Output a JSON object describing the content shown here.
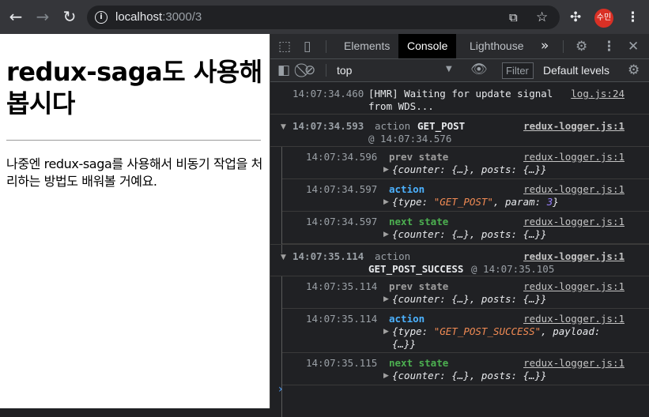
{
  "browser": {
    "url_host": "localhost",
    "url_path": ":3000/3",
    "avatar_text": "수민",
    "accent": "#d93025",
    "icons": [
      "back-arrow-icon",
      "forward-arrow-icon",
      "reload-icon",
      "info-icon",
      "translate-icon",
      "star-icon",
      "puzzle-icon",
      "kebab-menu-icon"
    ]
  },
  "page": {
    "heading": "redux-saga도 사용해봅시다",
    "body": "나중엔 redux-saga를 사용해서 비동기 작업을 처리하는 방법도 배워볼 거예요."
  },
  "devtools": {
    "tabs": [
      {
        "label": "Elements"
      },
      {
        "label": "Console"
      },
      {
        "label": "Lighthouse"
      }
    ],
    "more_tabs": "»",
    "context": "top",
    "filter_placeholder": "Filter",
    "levels": "Default levels",
    "colors": {
      "action": "#4cb2ff",
      "prev_state": "#9e9e9e",
      "next_state": "#4caf50",
      "string": "#f28b54",
      "number": "#9980ff"
    }
  },
  "console": {
    "hmr": {
      "time": "14:07:34.460",
      "msg1": "[HMR] Waiting for update signal",
      "msg2": "from WDS...",
      "link": "log.js:24"
    },
    "groups": [
      {
        "time": "14:07:34.593",
        "label": "action",
        "action": "GET_POST",
        "at": "@ 14:07:34.576",
        "link": "redux-logger.js:1",
        "prev": {
          "time": "14:07:34.596",
          "label": "prev state",
          "value": "{counter: {…}, posts: {…}}",
          "link": "redux-logger.js:1"
        },
        "act": {
          "time": "14:07:34.597",
          "label": "action",
          "pre": "{type: ",
          "type": "\"GET_POST\"",
          "mid": ", param: ",
          "param": "3",
          "post": "}",
          "link": "redux-logger.js:1"
        },
        "next": {
          "time": "14:07:34.597",
          "label": "next state",
          "value": "{counter: {…}, posts: {…}}",
          "link": "redux-logger.js:1"
        }
      },
      {
        "time": "14:07:35.114",
        "label": "action",
        "action": "GET_POST_SUCCESS",
        "at": "@ 14:07:35.105",
        "link": "redux-logger.js:1",
        "prev": {
          "time": "14:07:35.114",
          "label": "prev state",
          "value": "{counter: {…}, posts: {…}}",
          "link": "redux-logger.js:1"
        },
        "act": {
          "time": "14:07:35.114",
          "label": "action",
          "pre": "{type: ",
          "type": "\"GET_POST_SUCCESS\"",
          "mid": ", payload:",
          "tail": "{…}}",
          "link": "redux-logger.js:1"
        },
        "next": {
          "time": "14:07:35.115",
          "label": "next state",
          "value": "{counter: {…}, posts: {…}}",
          "link": "redux-logger.js:1"
        }
      }
    ],
    "prompt": "›"
  }
}
